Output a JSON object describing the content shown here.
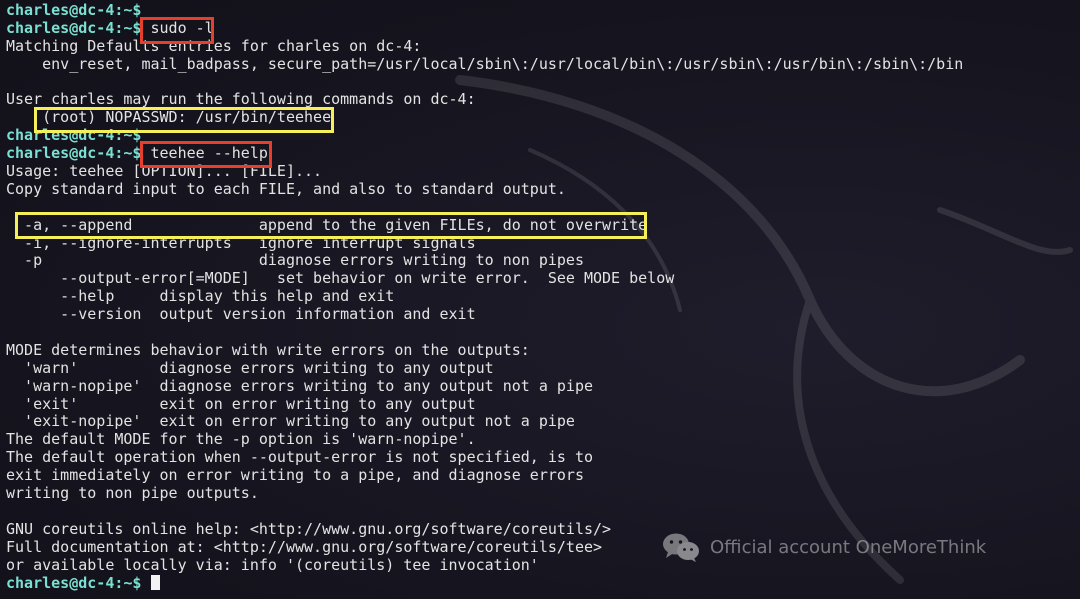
{
  "terminal": {
    "prompt": "charles@dc-4:~$",
    "lines": [
      {
        "prompt": true,
        "text": ""
      },
      {
        "prompt": true,
        "text": " sudo -l"
      },
      {
        "prompt": false,
        "text": "Matching Defaults entries for charles on dc-4:"
      },
      {
        "prompt": false,
        "text": "    env_reset, mail_badpass, secure_path=/usr/local/sbin\\:/usr/local/bin\\:/usr/sbin\\:/usr/bin\\:/sbin\\:/bin"
      },
      {
        "prompt": false,
        "text": ""
      },
      {
        "prompt": false,
        "text": "User charles may run the following commands on dc-4:"
      },
      {
        "prompt": false,
        "text": "    (root) NOPASSWD: /usr/bin/teehee"
      },
      {
        "prompt": true,
        "text": ""
      },
      {
        "prompt": true,
        "text": " teehee --help"
      },
      {
        "prompt": false,
        "text": "Usage: teehee [OPTION]... [FILE]..."
      },
      {
        "prompt": false,
        "text": "Copy standard input to each FILE, and also to standard output."
      },
      {
        "prompt": false,
        "text": ""
      },
      {
        "prompt": false,
        "text": "  -a, --append              append to the given FILEs, do not overwrite"
      },
      {
        "prompt": false,
        "text": "  -i, --ignore-interrupts   ignore interrupt signals"
      },
      {
        "prompt": false,
        "text": "  -p                        diagnose errors writing to non pipes"
      },
      {
        "prompt": false,
        "text": "      --output-error[=MODE]   set behavior on write error.  See MODE below"
      },
      {
        "prompt": false,
        "text": "      --help     display this help and exit"
      },
      {
        "prompt": false,
        "text": "      --version  output version information and exit"
      },
      {
        "prompt": false,
        "text": ""
      },
      {
        "prompt": false,
        "text": "MODE determines behavior with write errors on the outputs:"
      },
      {
        "prompt": false,
        "text": "  'warn'         diagnose errors writing to any output"
      },
      {
        "prompt": false,
        "text": "  'warn-nopipe'  diagnose errors writing to any output not a pipe"
      },
      {
        "prompt": false,
        "text": "  'exit'         exit on error writing to any output"
      },
      {
        "prompt": false,
        "text": "  'exit-nopipe'  exit on error writing to any output not a pipe"
      },
      {
        "prompt": false,
        "text": "The default MODE for the -p option is 'warn-nopipe'."
      },
      {
        "prompt": false,
        "text": "The default operation when --output-error is not specified, is to"
      },
      {
        "prompt": false,
        "text": "exit immediately on error writing to a pipe, and diagnose errors"
      },
      {
        "prompt": false,
        "text": "writing to non pipe outputs."
      },
      {
        "prompt": false,
        "text": ""
      },
      {
        "prompt": false,
        "text": "GNU coreutils online help: <http://www.gnu.org/software/coreutils/>"
      },
      {
        "prompt": false,
        "text": "Full documentation at: <http://www.gnu.org/software/coreutils/tee>"
      },
      {
        "prompt": false,
        "text": "or available locally via: info '(coreutils) tee invocation'"
      },
      {
        "prompt": true,
        "text": " ",
        "cursor": true
      }
    ]
  },
  "colors": {
    "background": "#171421",
    "prompt": "#7be0d2",
    "text": "#e3e3e3",
    "highlight_red": "#e5402d",
    "highlight_yellow": "#f5f05a"
  },
  "watermark": {
    "icon": "wechat-icon",
    "text": "Official account OneMoreThink"
  }
}
